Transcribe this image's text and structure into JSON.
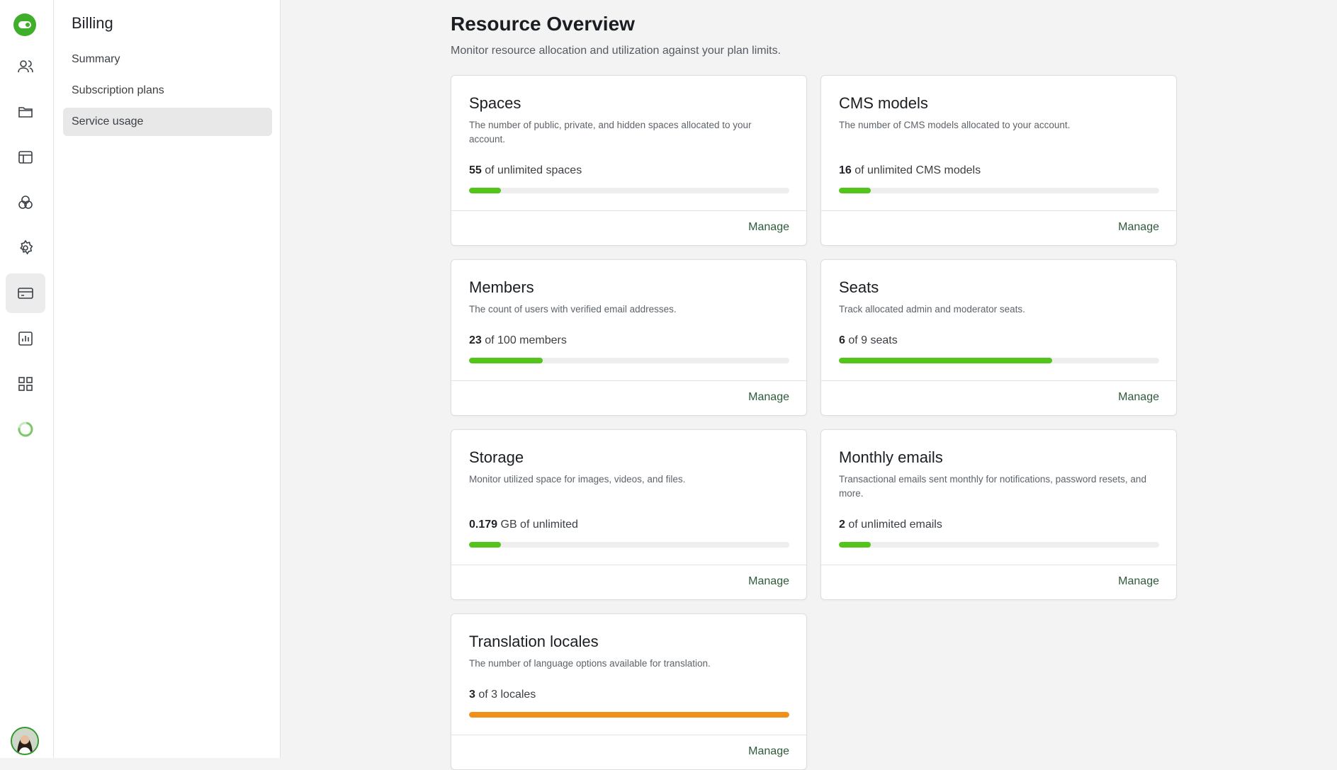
{
  "nav": {
    "icons": [
      "toggle-logo-icon",
      "users-icon",
      "folder-icon",
      "layout-icon",
      "circles-icon",
      "gear-icon",
      "credit-card-icon",
      "bar-chart-icon",
      "grid-icon",
      "spinner-icon"
    ],
    "active_icon": "credit-card-icon"
  },
  "sidebar": {
    "title": "Billing",
    "items": [
      {
        "label": "Summary"
      },
      {
        "label": "Subscription plans"
      },
      {
        "label": "Service usage"
      }
    ],
    "active_index": 2
  },
  "page": {
    "title": "Resource Overview",
    "subtitle": "Monitor resource allocation and utilization against your plan limits."
  },
  "cards": [
    {
      "title": "Spaces",
      "description": "The number of public, private, and hidden spaces allocated to your account.",
      "used": "55",
      "limit_text": " of unlimited spaces",
      "progress": 0.1,
      "bar_color": "#52c41a",
      "action": "Manage"
    },
    {
      "title": "CMS models",
      "description": "The number of CMS models allocated to your account.",
      "used": "16",
      "limit_text": " of unlimited CMS models",
      "progress": 0.1,
      "bar_color": "#52c41a",
      "action": "Manage"
    },
    {
      "title": "Members",
      "description": "The count of users with verified email addresses.",
      "used": "23",
      "limit_text": " of 100 members",
      "progress": 0.23,
      "bar_color": "#52c41a",
      "action": "Manage"
    },
    {
      "title": "Seats",
      "description": "Track allocated admin and moderator seats.",
      "used": "6",
      "limit_text": " of 9 seats",
      "progress": 0.667,
      "bar_color": "#52c41a",
      "action": "Manage"
    },
    {
      "title": "Storage",
      "description": "Monitor utilized space for images, videos, and files.",
      "used": "0.179",
      "limit_text": " GB of unlimited",
      "progress": 0.1,
      "bar_color": "#52c41a",
      "action": "Manage"
    },
    {
      "title": "Monthly emails",
      "description": "Transactional emails sent monthly for notifications, password resets, and more.",
      "used": "2",
      "limit_text": " of unlimited emails",
      "progress": 0.1,
      "bar_color": "#52c41a",
      "action": "Manage"
    },
    {
      "title": "Translation locales",
      "description": "The number of language options available for translation.",
      "used": "3",
      "limit_text": " of 3 locales",
      "progress": 1.0,
      "bar_color": "#f0901b",
      "action": "Manage"
    }
  ]
}
